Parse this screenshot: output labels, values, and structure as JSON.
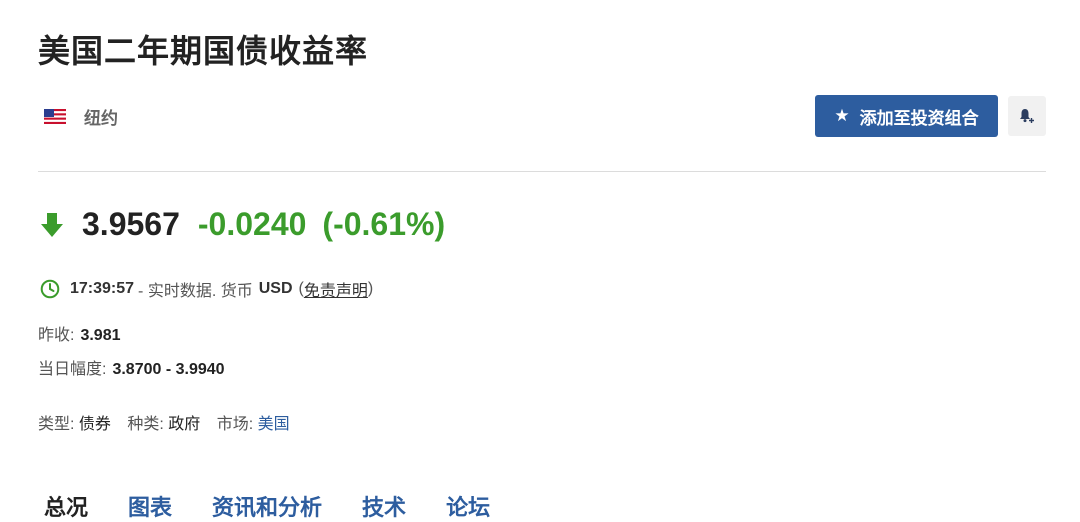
{
  "header": {
    "title": "美国二年期国债收益率"
  },
  "exchange": {
    "flag_icon": "us-flag-icon",
    "name": "纽约"
  },
  "actions": {
    "add_portfolio_label": "添加至投资组合",
    "alert_icon": "bell-plus-icon"
  },
  "quote": {
    "last": "3.9567",
    "change": "-0.0240",
    "change_pct": "(-0.61%)",
    "direction": "down",
    "down_color": "#3b9c2c"
  },
  "timeline": {
    "time": "17:39:57",
    "realtime_text": "- 实时数据. 货币",
    "currency": "USD",
    "open_paren": "(",
    "disclaimer": "免责声明",
    "close_paren": ")"
  },
  "stats": {
    "prev_close_label": "昨收:",
    "prev_close_value": "3.981",
    "day_range_label": "当日幅度:",
    "day_range_value": "3.8700 - 3.9940"
  },
  "meta": {
    "type_label": "类型:",
    "type_value": "债券",
    "kind_label": "种类:",
    "kind_value": "政府",
    "market_label": "市场:",
    "market_value": "美国"
  },
  "tabs": [
    {
      "label": "总况"
    },
    {
      "label": "图表"
    },
    {
      "label": "资讯和分析"
    },
    {
      "label": "技术"
    },
    {
      "label": "论坛"
    }
  ]
}
